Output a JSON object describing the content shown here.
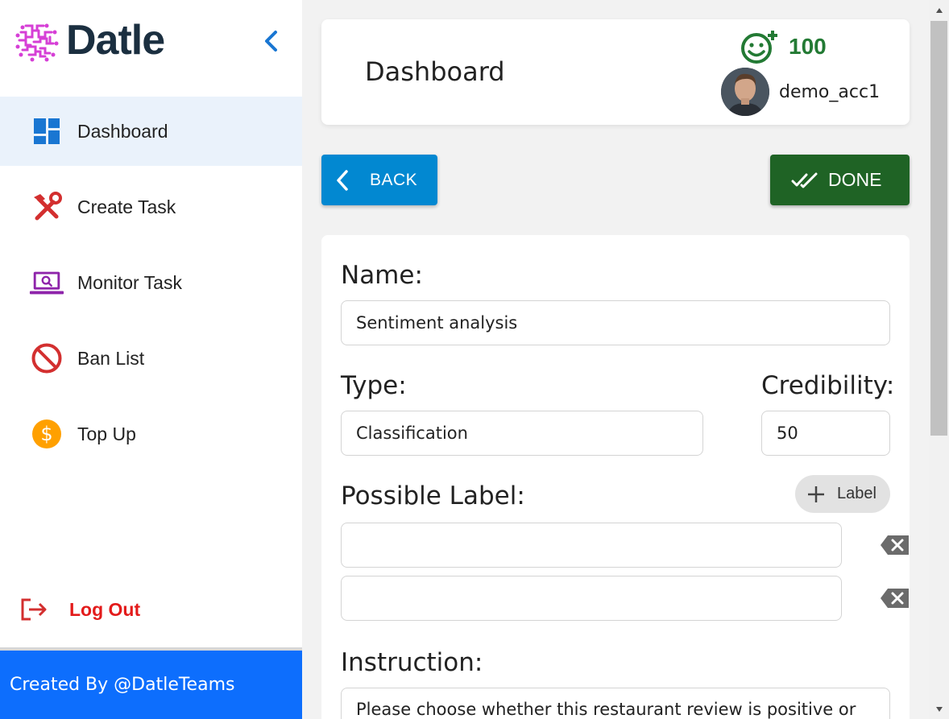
{
  "brand": {
    "name": "Datle"
  },
  "sidebar": {
    "items": [
      {
        "label": "Dashboard",
        "icon": "dashboard-icon"
      },
      {
        "label": "Create Task",
        "icon": "tools-icon"
      },
      {
        "label": "Monitor Task",
        "icon": "laptop-search-icon"
      },
      {
        "label": "Ban List",
        "icon": "ban-icon"
      },
      {
        "label": "Top Up",
        "icon": "dollar-coin-icon"
      }
    ],
    "logout_label": "Log Out",
    "footer_text": "Created By @DatleTeams"
  },
  "header": {
    "title": "Dashboard",
    "points": "100",
    "username": "demo_acc1"
  },
  "actions": {
    "back_label": "BACK",
    "done_label": "DONE"
  },
  "form": {
    "name_label": "Name:",
    "name_value": "Sentiment analysis",
    "type_label": "Type:",
    "type_value": "Classification",
    "credibility_label": "Credibility:",
    "credibility_value": "50",
    "possible_label_label": "Possible Label:",
    "add_label_button": "Label",
    "labels": [
      "",
      ""
    ],
    "instruction_label": "Instruction:",
    "instruction_value": "Please choose whether this restaurant review is positive or"
  },
  "colors": {
    "primary": "#0288d1",
    "done": "#1f6325",
    "points": "#237a34",
    "logout": "#e31b1b",
    "footer": "#0d6efd",
    "brand_logo": "#d63fd6"
  }
}
